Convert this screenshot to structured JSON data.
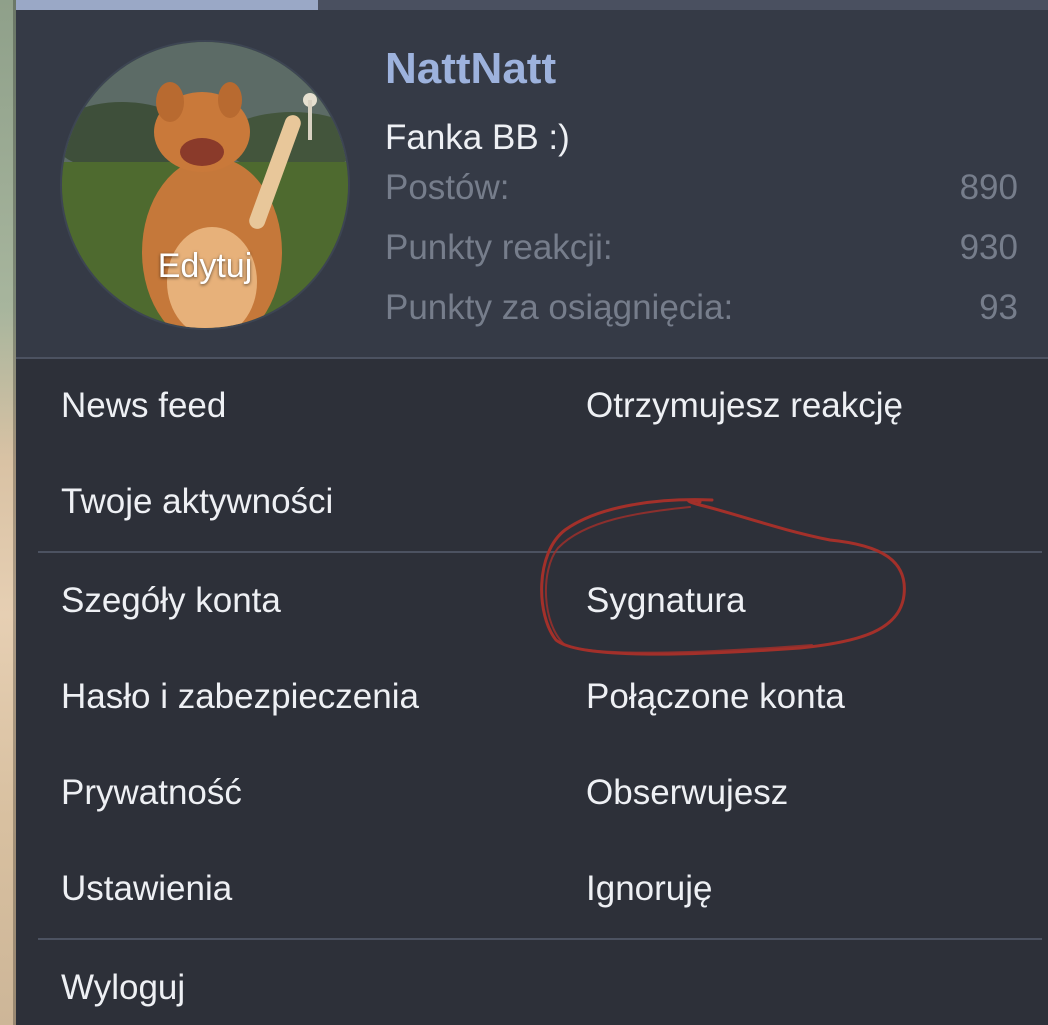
{
  "user": {
    "name": "NattNatt",
    "title": "Fanka BB :)",
    "avatar_edit_label": "Edytuj"
  },
  "stats": [
    {
      "label": "Postów:",
      "value": "890"
    },
    {
      "label": "Punkty reakcji:",
      "value": "930"
    },
    {
      "label": "Punkty za osiągnięcia:",
      "value": "93"
    }
  ],
  "menu": {
    "news_feed": "News feed",
    "reactions_received": "Otrzymujesz reakcję",
    "your_activity": "Twoje aktywności",
    "account_details": "Szegóły konta",
    "signature": "Sygnatura",
    "password_security": "Hasło i zabezpieczenia",
    "connected_accounts": "Połączone konta",
    "privacy": "Prywatność",
    "following": "Obserwujesz",
    "settings": "Ustawienia",
    "ignoring": "Ignoruję",
    "logout": "Wyloguj"
  },
  "colors": {
    "background": "#2d3039",
    "header_background": "#353a46",
    "username": "#9db2dd",
    "annotation": "#a3302a"
  }
}
